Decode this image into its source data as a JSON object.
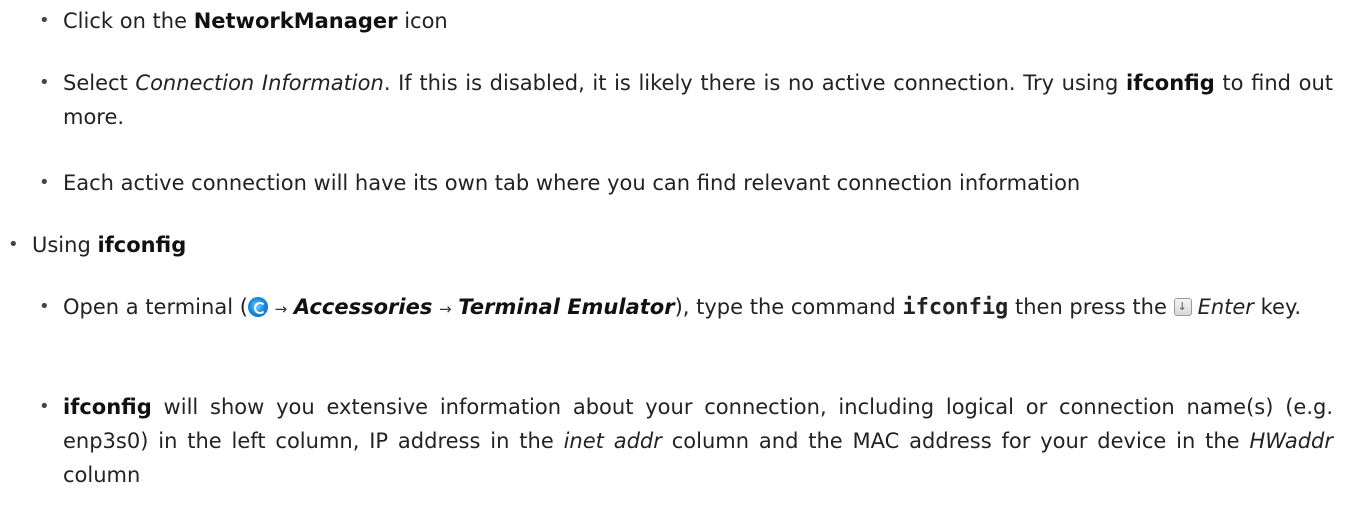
{
  "bullet_char": "•",
  "items": [
    {
      "prefix": "Click on the ",
      "bold": "NetworkManager",
      "suffix": " icon"
    },
    {
      "prefix": "Select ",
      "italic": "Connection Information",
      "mid": ". If this is disabled, it is likely there is no active connection. Try using ",
      "bold": "ifconfig",
      "suffix": " to find out more."
    },
    {
      "text": "Each active connection will have its own tab where you can find relevant connection information"
    },
    {
      "prefix": "Using ",
      "bold": "ifconfig"
    },
    {
      "prefix": "Open a terminal (",
      "arrow": "→",
      "menu1": "Accessories",
      "menu2": "Terminal Emulator",
      "mid": "), type the command ",
      "command": "ifconfig",
      "mid2": " then press the ",
      "key": "Enter",
      "suffix": " key."
    },
    {
      "bold": "ifconfig",
      "part1": " will show you extensive information about your connection, including logical or connection name(s) (e.g. enp3s0) in the left column, IP address in the ",
      "italic1": "inet addr",
      "part2": " column and the MAC address for your device in the ",
      "italic2": "HWaddr",
      "part3": " column"
    }
  ]
}
